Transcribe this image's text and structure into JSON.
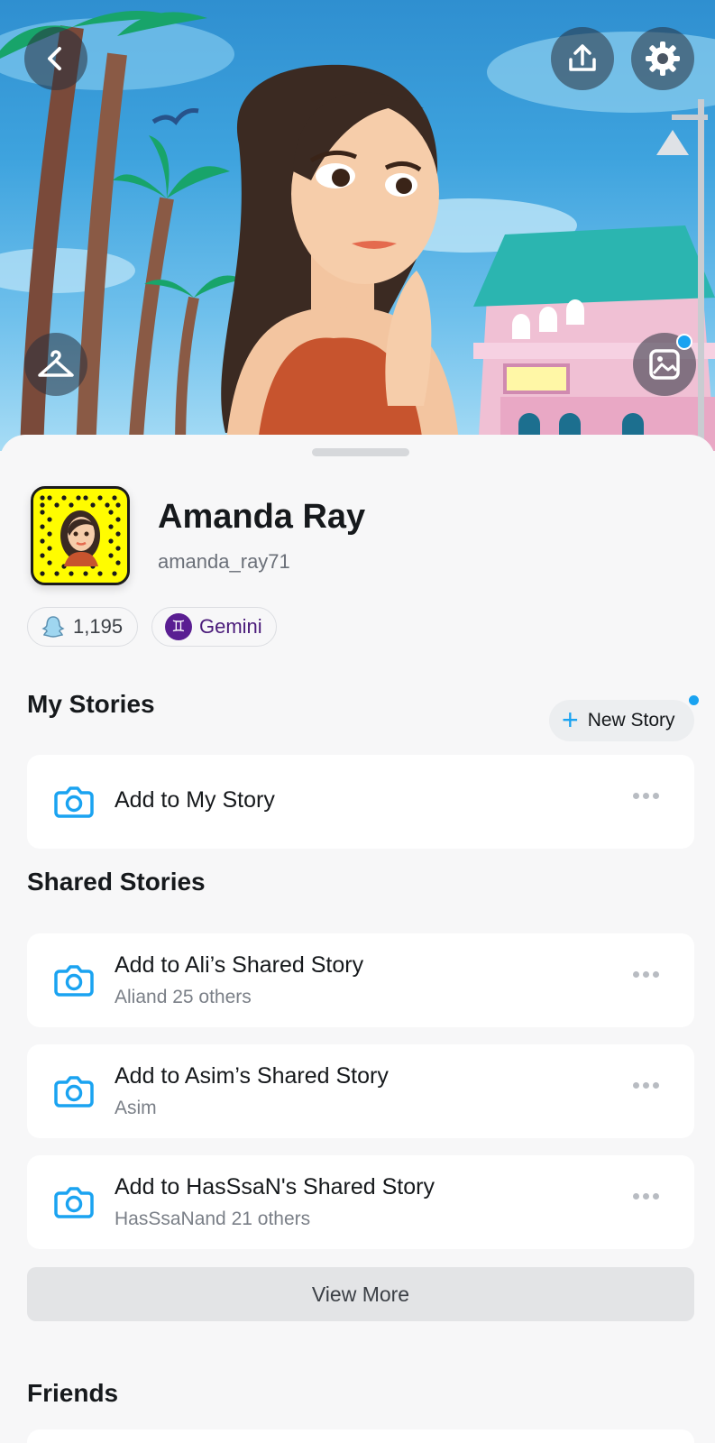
{
  "hero": {
    "back_icon": "chevron-left-icon",
    "share_icon": "upload-icon",
    "settings_icon": "gear-icon",
    "outfit_icon": "hanger-icon",
    "background_icon": "image-icon"
  },
  "profile": {
    "display_name": "Amanda Ray",
    "username": "amanda_ray71",
    "snap_score": "1,195",
    "zodiac": "Gemini",
    "zodiac_symbol": "♊"
  },
  "my_stories": {
    "title": "My Stories",
    "new_story_label": "New Story",
    "items": [
      {
        "title": "Add to My Story",
        "subtitle": ""
      }
    ]
  },
  "shared_stories": {
    "title": "Shared Stories",
    "items": [
      {
        "title": "Add to Ali’s Shared Story",
        "subtitle": "Aliand 25 others"
      },
      {
        "title": "Add to Asim’s Shared Story",
        "subtitle": "Asim"
      },
      {
        "title": "Add to HasSsaN's Shared Story",
        "subtitle": "HasSsaNand 21 others"
      }
    ],
    "view_more_label": "View More"
  },
  "friends": {
    "title": "Friends"
  },
  "colors": {
    "accent_blue": "#1aa3f1",
    "snap_yellow": "#fffc00",
    "zodiac_purple": "#5a1e92"
  }
}
